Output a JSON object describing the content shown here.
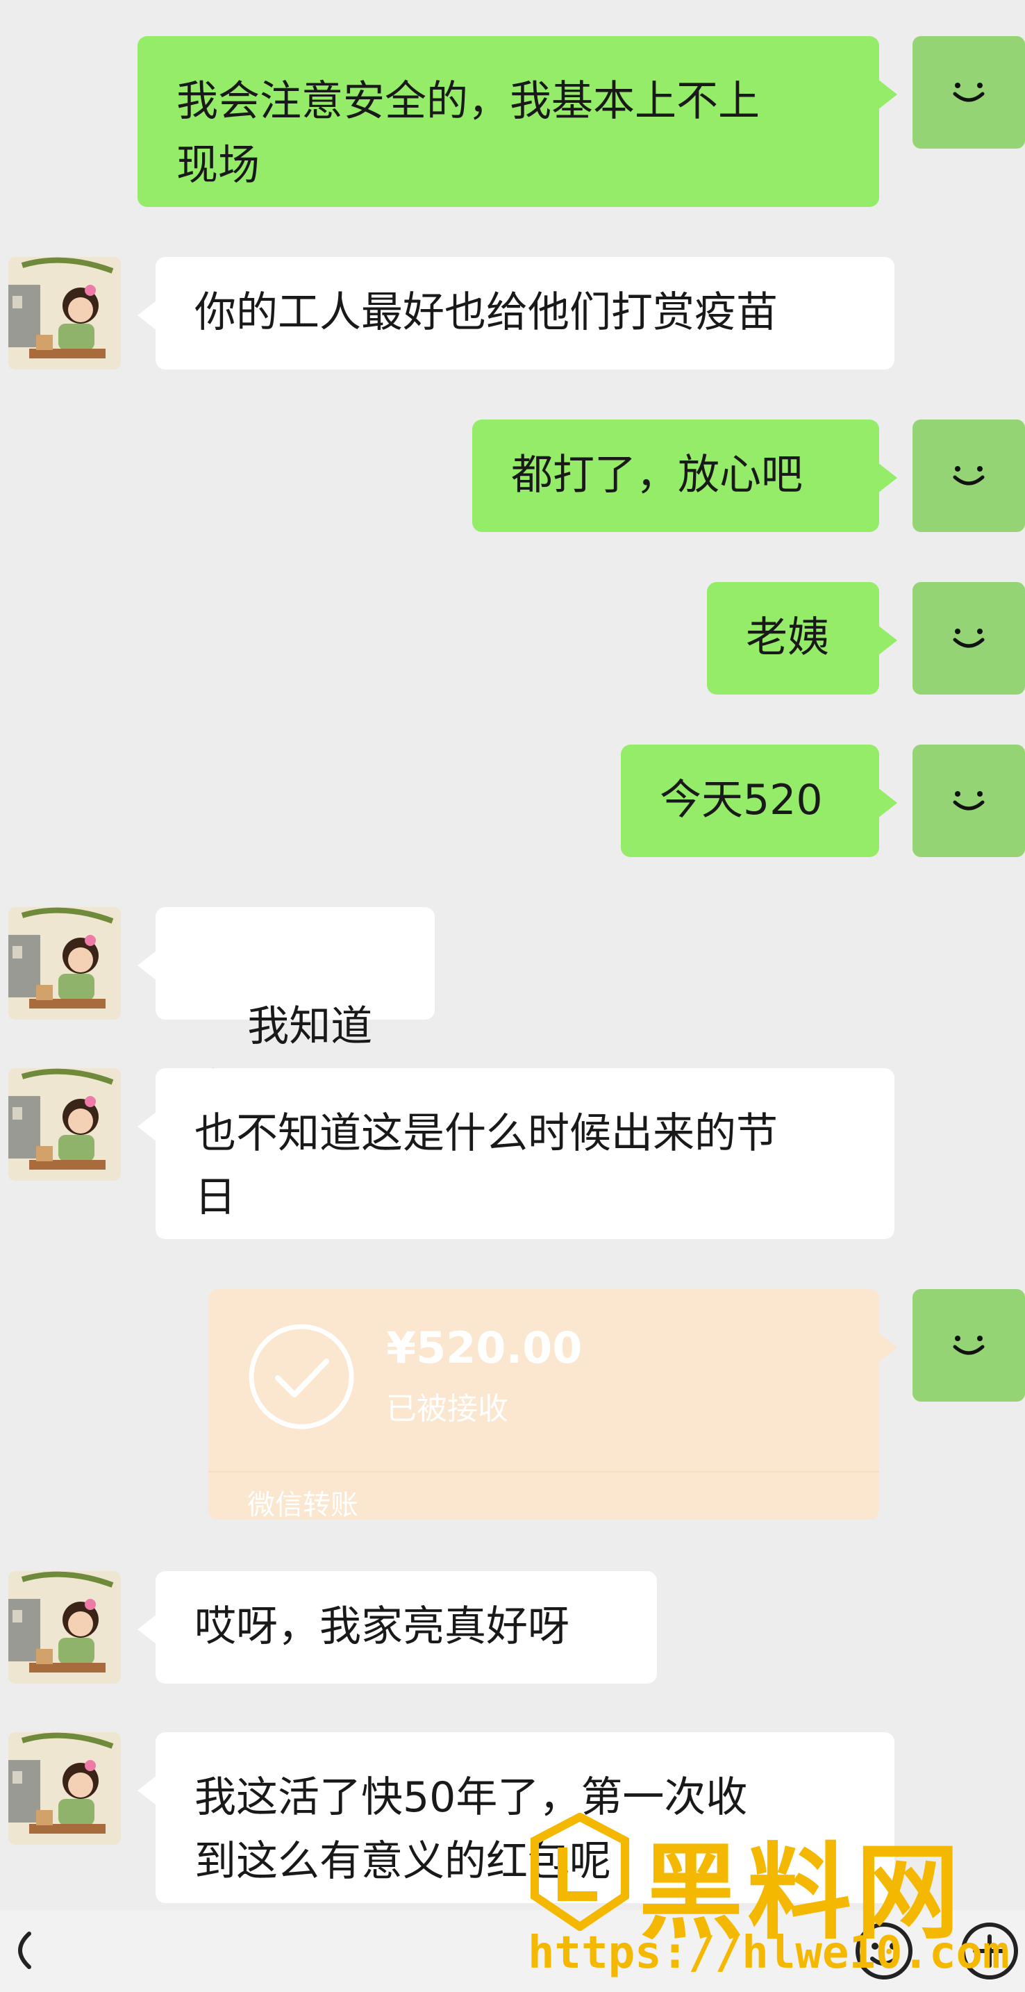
{
  "messages": [
    {
      "sender": "me",
      "text": "我会注意安全的，我基本上不上\n现场"
    },
    {
      "sender": "other",
      "text": "你的工人最好也给他们打赏疫苗"
    },
    {
      "sender": "me",
      "text": "都打了，放心吧"
    },
    {
      "sender": "me",
      "text": "老姨"
    },
    {
      "sender": "me",
      "text": "今天520"
    },
    {
      "sender": "other",
      "text": "我知道",
      "emoji": "🤔"
    },
    {
      "sender": "other",
      "text": "也不知道这是什么时候出来的节\n日"
    },
    {
      "sender": "me",
      "type": "transfer",
      "amount": "¥520.00",
      "status": "已被接收",
      "brand": "微信转账"
    },
    {
      "sender": "other",
      "text": "哎呀，我家亮真好呀"
    },
    {
      "sender": "other",
      "text": "我这活了快50年了，第一次收\n到这么有意义的红包呢"
    }
  ],
  "icons": {
    "my_avatar": "smiley-face-icon",
    "other_avatar": "cartoon-girl-avatar-icon",
    "transfer_check": "check-circle-icon",
    "back": "back-arrow-icon",
    "emoji_button": "smiley-button-icon",
    "add_button": "plus-circle-icon"
  },
  "watermark": {
    "name": "黑料网",
    "url": "https://hlwe10.com"
  },
  "colors": {
    "chat_background": "#ededed",
    "my_bubble": "#95ec69",
    "other_bubble": "#ffffff",
    "transfer_card": "#fbe6cf",
    "watermark": "#f5b800"
  }
}
